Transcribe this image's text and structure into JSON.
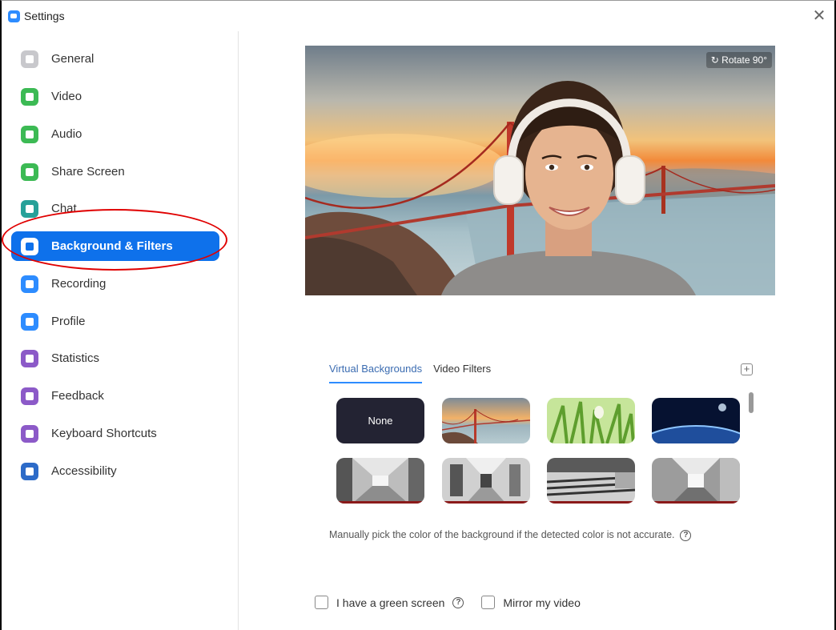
{
  "window": {
    "title": "Settings",
    "close_glyph": "✕"
  },
  "sidebar": {
    "items": [
      {
        "label": "General",
        "icon": "general-icon",
        "color": "#c8c8cc"
      },
      {
        "label": "Video",
        "icon": "video-icon",
        "color": "#3cba54"
      },
      {
        "label": "Audio",
        "icon": "audio-icon",
        "color": "#3cba54"
      },
      {
        "label": "Share Screen",
        "icon": "share-screen-icon",
        "color": "#3cba54"
      },
      {
        "label": "Chat",
        "icon": "chat-icon",
        "color": "#27a199"
      },
      {
        "label": "Background & Filters",
        "icon": "background-icon",
        "color": "#0e71eb",
        "active": true
      },
      {
        "label": "Recording",
        "icon": "recording-icon",
        "color": "#2d8cff"
      },
      {
        "label": "Profile",
        "icon": "profile-icon",
        "color": "#2d8cff"
      },
      {
        "label": "Statistics",
        "icon": "statistics-icon",
        "color": "#8c5ac8"
      },
      {
        "label": "Feedback",
        "icon": "feedback-icon",
        "color": "#8c5ac8"
      },
      {
        "label": "Keyboard Shortcuts",
        "icon": "keyboard-icon",
        "color": "#8c5ac8"
      },
      {
        "label": "Accessibility",
        "icon": "accessibility-icon",
        "color": "#2d6bc8"
      }
    ]
  },
  "preview": {
    "rotate_label": "Rotate 90°"
  },
  "tabs": [
    {
      "label": "Virtual Backgrounds",
      "active": true
    },
    {
      "label": "Video Filters",
      "active": false
    }
  ],
  "add_glyph": "+",
  "thumbnails": [
    {
      "label": "None"
    },
    {
      "label": "",
      "image": "golden-gate-bridge"
    },
    {
      "label": "",
      "image": "grass"
    },
    {
      "label": "",
      "image": "earth-from-space"
    },
    {
      "label": "",
      "image": "hallway-1"
    },
    {
      "label": "",
      "image": "hallway-2"
    },
    {
      "label": "",
      "image": "lecture-room"
    },
    {
      "label": "",
      "image": "corridor"
    }
  ],
  "manual_pick_text": "Manually pick the color of the background if the detected color is not accurate.",
  "help_glyph": "?",
  "options": {
    "green_screen_label": "I have a green screen",
    "mirror_label": "Mirror my video"
  },
  "colors": {
    "accent": "#0e71eb",
    "highlight_oval": "#e00000"
  }
}
